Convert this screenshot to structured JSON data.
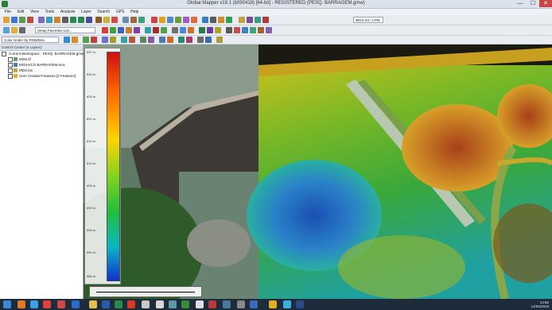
{
  "window": {
    "title": "Global Mapper v19.1 (b050418) [64-bit] - REGISTERED (PESQ. BARRAGEM.gmw)",
    "min": "—",
    "max": "☐",
    "close": "✕"
  },
  "menu": [
    "File",
    "Edit",
    "View",
    "Tools",
    "Analysis",
    "Layer",
    "Search",
    "GPS",
    "Help"
  ],
  "toolbar": {
    "digitizer_combo": "Setup Favorites List...",
    "projection_combo": "WGS 84 / UTM",
    "shader_combo": "Color Under by RGB/Elev"
  },
  "control_center": {
    "title": "Control Center (4 Layers)",
    "workspace": "Current Workspace - PESQ. BARRAGEM.gmw",
    "layers": [
      {
        "label": "MDS.tif",
        "checked": true
      },
      {
        "label": "MOSAICO BARRAGEM.ecw",
        "checked": true
      },
      {
        "label": "MDS.las",
        "checked": true
      },
      {
        "label": "User Created Features [2 Features]",
        "checked": true
      }
    ]
  },
  "legend": {
    "ticks": [
      "637 m",
      "630 m",
      "625 m",
      "620 m",
      "615 m",
      "610 m",
      "605 m",
      "600 m",
      "595 m",
      "590 m",
      "585 m"
    ]
  },
  "status_bar": {
    "tray_time": "14:56",
    "tray_date": "14/05/2018"
  },
  "colors": {
    "taskbar": "#1e2b3a",
    "legend_high": "#d01010",
    "legend_low": "#1030d0"
  }
}
